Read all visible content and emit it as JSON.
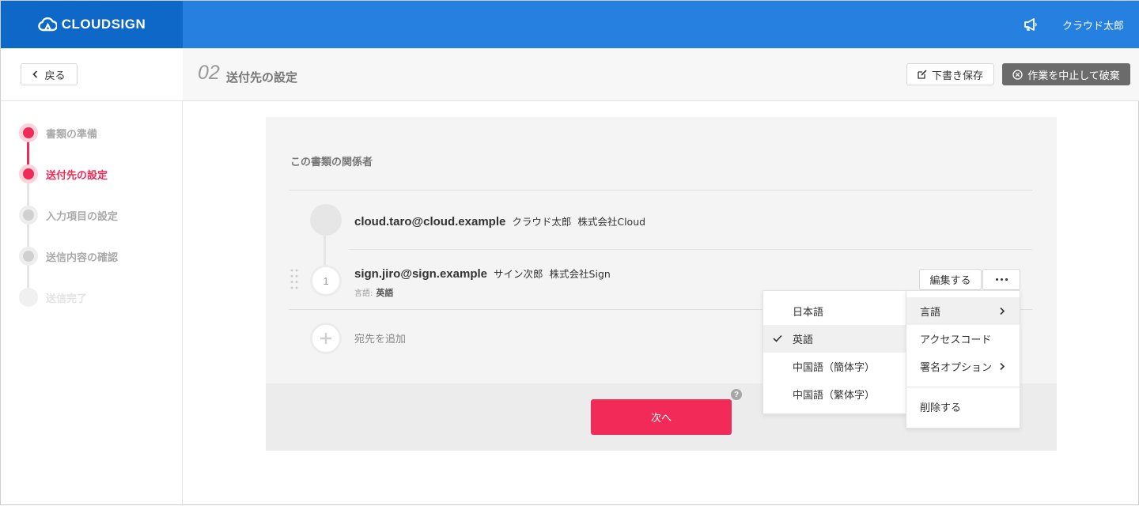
{
  "header": {
    "logo_text": "CLOUDSIGN",
    "user_name": "クラウド太郎",
    "brand_color": "#2680e0",
    "logo_bg": "#0d68c8"
  },
  "subheader": {
    "back_label": "戻る",
    "step_number": "02",
    "step_title": "送付先の設定",
    "draft_label": "下書き保存",
    "discard_label": "作業を中止して破棄"
  },
  "sidebar": {
    "steps": [
      {
        "label": "書類の準備",
        "state": "done"
      },
      {
        "label": "送付先の設定",
        "state": "active"
      },
      {
        "label": "入力項目の設定",
        "state": "pending"
      },
      {
        "label": "送信内容の確認",
        "state": "pending"
      },
      {
        "label": "送信完了",
        "state": "disabled"
      }
    ],
    "accent_color": "#ef2b57"
  },
  "main": {
    "section_title": "この書類の関係者",
    "sender": {
      "email": "cloud.taro@cloud.example",
      "name": "クラウド太郎",
      "company": "株式会社Cloud"
    },
    "recipients": [
      {
        "number": "1",
        "email": "sign.jiro@sign.example",
        "name": "サイン次郎",
        "company": "株式会社Sign",
        "language_key": "言語:",
        "language_value": "英語"
      }
    ],
    "add_recipient_label": "宛先を追加",
    "edit_label": "編集する",
    "next_label": "次へ",
    "help_glyph": "?"
  },
  "context_menu": {
    "items": [
      {
        "label": "言語",
        "has_submenu": true
      },
      {
        "label": "アクセスコード",
        "has_submenu": false
      },
      {
        "label": "署名オプション",
        "has_submenu": true
      },
      {
        "label": "削除する",
        "has_submenu": false
      }
    ]
  },
  "language_menu": {
    "options": [
      "日本語",
      "英語",
      "中国語（簡体字）",
      "中国語（繁体字）"
    ],
    "selected": "英語"
  }
}
